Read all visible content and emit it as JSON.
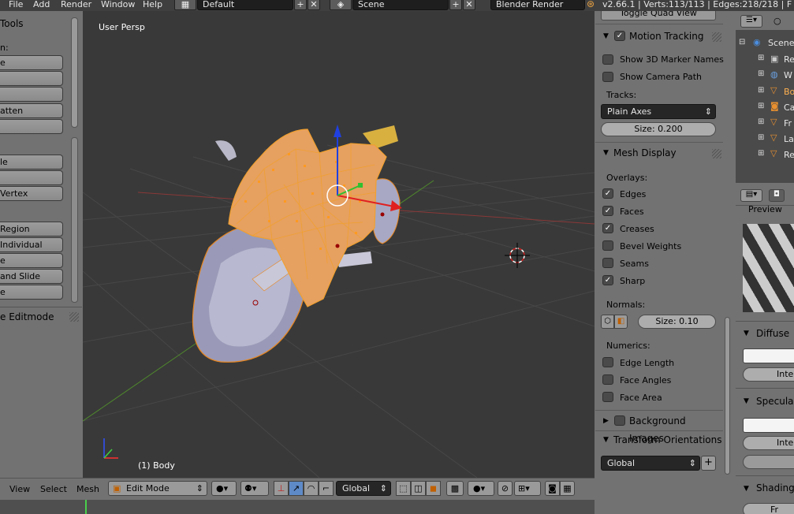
{
  "menu": {
    "file": "File",
    "add": "Add",
    "render": "Render",
    "window": "Window",
    "help": "Help"
  },
  "header": {
    "layout": "Default",
    "scene": "Scene",
    "engine": "Blender Render",
    "stats": "v2.66.1 | Verts:113/113 | Edges:218/218 | F"
  },
  "tools": {
    "title": "Tools",
    "section_label": "n:",
    "buttons": [
      "e",
      "",
      "",
      "atten",
      "",
      "le",
      "",
      "Vertex",
      "Region",
      "Individual",
      "e",
      "and Slide",
      "e"
    ],
    "footer": "e Editmode"
  },
  "viewport": {
    "view_label": "User Persp",
    "object_label": "(1) Body"
  },
  "props": {
    "toggle_quad": "Toggle Quad View",
    "motion_tracking": {
      "title": "Motion Tracking",
      "show_markers": "Show 3D Marker Names",
      "show_camera_path": "Show Camera Path",
      "tracks_label": "Tracks:",
      "tracks_value": "Plain Axes",
      "size": "Size: 0.200"
    },
    "mesh_display": {
      "title": "Mesh Display",
      "overlays_label": "Overlays:",
      "edges": "Edges",
      "faces": "Faces",
      "creases": "Creases",
      "bevel_weights": "Bevel Weights",
      "seams": "Seams",
      "sharp": "Sharp",
      "normals_label": "Normals:",
      "normals_size": "Size: 0.10",
      "numerics_label": "Numerics:",
      "edge_length": "Edge Length",
      "face_angles": "Face Angles",
      "face_area": "Face Area"
    },
    "background_images": "Background Images",
    "transform_orientations": {
      "title": "Transform Orientations",
      "value": "Global"
    }
  },
  "outliner": {
    "scene": "Scene",
    "items": [
      "Re",
      "W",
      "Bo",
      "Ca",
      "Fr",
      "La",
      "Re"
    ]
  },
  "right_props": {
    "preview": "Preview",
    "diffuse": "Diffuse",
    "inten1": "Inter",
    "specular": "Specular",
    "inten2": "Inter",
    "shading": "Shading",
    "fr": "Fr"
  },
  "bottom": {
    "view": "View",
    "select": "Select",
    "mesh": "Mesh",
    "mode": "Edit Mode",
    "orientation": "Global"
  }
}
